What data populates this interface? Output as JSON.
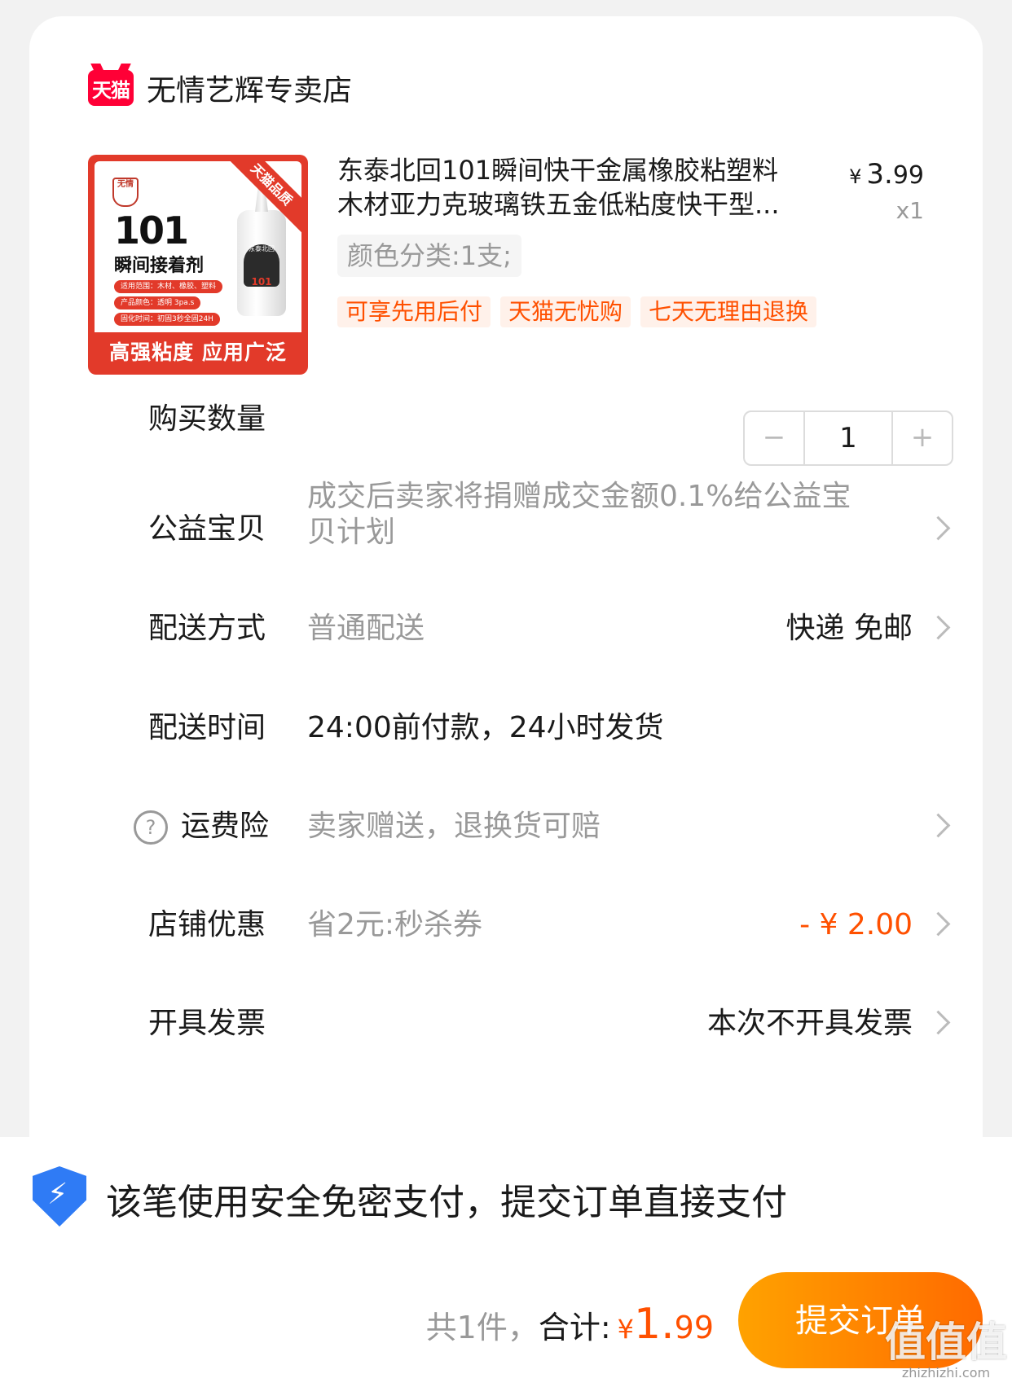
{
  "store": {
    "logo_text": "天猫",
    "name": "无情艺辉专卖店"
  },
  "product": {
    "title_line1": "东泰北回101瞬间快干金属橡胶粘塑料",
    "title_line2": "木材亚力克玻璃铁五金低粘度快干型...",
    "price_currency": "¥",
    "price_int": "3.",
    "price_dec": "99",
    "quantity_text": "x1",
    "variant": "颜色分类:1支;",
    "tags": [
      "可享先用后付",
      "天猫无忧购",
      "七天无理由退换"
    ],
    "thumbnail": {
      "ribbon": "天猫品质",
      "badge": "无情",
      "big_number": "101",
      "title": "瞬间接着剂",
      "line1": "适用范围：木材、橡胶、塑料",
      "line2": "产品颜色：透明 3pa.s",
      "line3": "固化时间：初固3秒全固24H",
      "bottle_label": "东泰北回",
      "bottle_number": "101",
      "bottom_text": "高强粘度 应用广泛"
    }
  },
  "quantity": {
    "label": "购买数量",
    "minus": "−",
    "value": "1",
    "plus": "+"
  },
  "welfare": {
    "label": "公益宝贝",
    "value": "成交后卖家将捐赠成交金额0.1%给公益宝贝计划"
  },
  "delivery": {
    "label": "配送方式",
    "value": "普通配送",
    "right": "快递 免邮"
  },
  "delivery_time": {
    "label": "配送时间",
    "value": "24:00前付款，24小时发货"
  },
  "insurance": {
    "help_glyph": "?",
    "label": "运费险",
    "value": "卖家赠送，退换货可赔"
  },
  "discount": {
    "label": "店铺优惠",
    "value": "省2元:秒杀券",
    "right": "- ¥ 2.00"
  },
  "invoice": {
    "label": "开具发票",
    "right": "本次不开具发票"
  },
  "footer": {
    "secure_text": "该笔使用安全免密支付，提交订单直接支付",
    "count_text": "共1件，",
    "total_label": "合计:",
    "total_currency": "¥",
    "total_int": "1.",
    "total_dec": "99",
    "submit_label": "提交订单"
  },
  "watermark": {
    "big": "值值值",
    "small": "zhizhizhi.com"
  },
  "colors": {
    "accent": "#ff5000",
    "tmall_red": "#ff0036",
    "submit_start": "#ffa200",
    "submit_end": "#ff6a00",
    "shield_blue": "#2f7bf5"
  }
}
